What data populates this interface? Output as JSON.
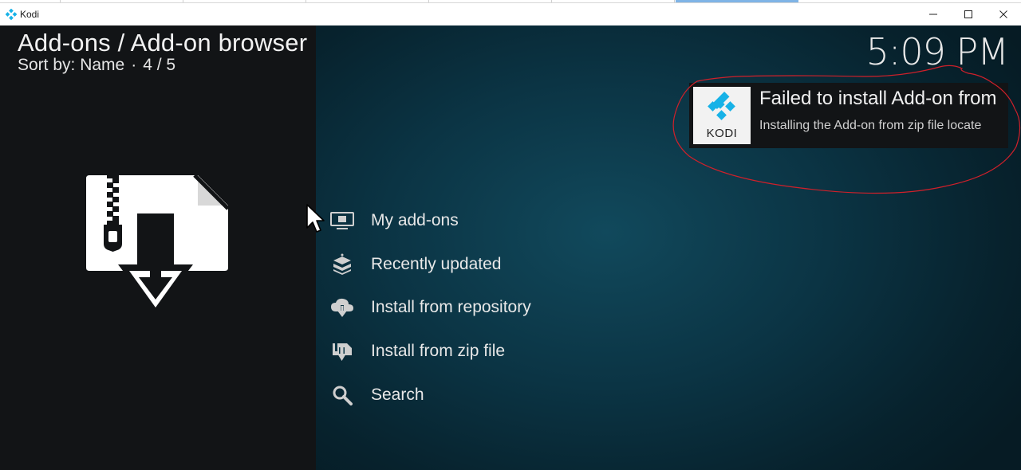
{
  "window": {
    "title": "Kodi",
    "app_icon": "kodi-logo-icon",
    "controls": [
      "minimize-icon",
      "maximize-icon",
      "close-icon"
    ]
  },
  "header": {
    "title": "Add-ons / Add-on browser",
    "sort_label": "Sort by: Name",
    "separator": "·",
    "position": "4 / 5",
    "clock": "5:09 PM"
  },
  "preview_icon": "zip-download-icon",
  "menu": {
    "items": [
      {
        "label": "My add-ons",
        "icon": "monitor-box-icon"
      },
      {
        "label": "Recently updated",
        "icon": "box-stack-icon"
      },
      {
        "label": "Install from repository",
        "icon": "cloud-download-icon"
      },
      {
        "label": "Install from zip file",
        "icon": "zip-install-icon"
      },
      {
        "label": "Search",
        "icon": "search-icon"
      }
    ]
  },
  "notification": {
    "logo_text": "KODI",
    "title": "Failed to install Add-on from",
    "message": "Installing the Add-on from zip file locate"
  },
  "colors": {
    "background_dark": "#121416",
    "background_teal": "#0e4556",
    "kodi_blue": "#17b2e7",
    "highlight_red": "#d0202a",
    "text": "#e8e8e8"
  }
}
